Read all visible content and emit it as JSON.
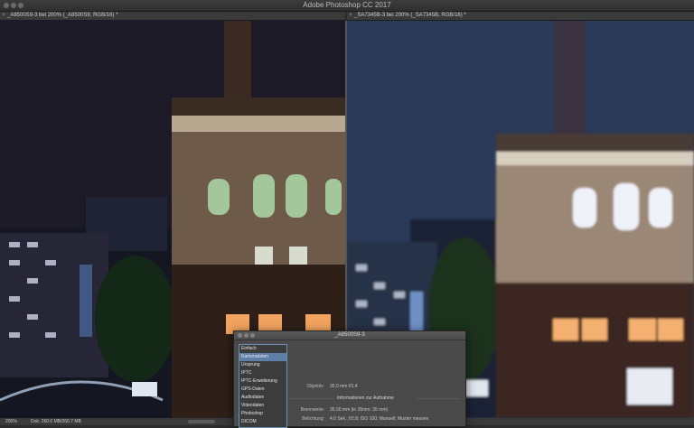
{
  "app": {
    "title": "Adobe Photoshop CC 2017"
  },
  "tabs": [
    {
      "label": "_A8500S9-3 bei 200% (_A8500S9, RGB/16) *"
    },
    {
      "label": "_SA7345B-3 bei 200% (_SA7345B, RGB/16) *"
    }
  ],
  "status": {
    "zoom": "200%",
    "doc": "Dok: 260.0 MB/260.7 MB"
  },
  "dialog": {
    "title": "_A8500S9-3",
    "categories": [
      "Einfach",
      "Kameradaten",
      "Ursprung",
      "IPTC",
      "IPTC-Erweiterung",
      "GPS-Daten",
      "Audiodaten",
      "Videodaten",
      "Photoshop",
      "DICOM"
    ],
    "selected_index": 1,
    "objektiv_label": "Objektiv:",
    "objektiv_value": "35.0 mm f/1.4",
    "section_heading": "Informationen zur Aufnahme",
    "brennweite_label": "Brennweite:",
    "brennweite_value": "35.00 mm  (in 35mm: 35 mm)",
    "belichtung_label": "Belichtung:",
    "belichtung_value": "4.0 Sek.;  f/2.8;  ISO 100;  Manuell;  Muster messen"
  },
  "colors": {
    "sky_left": "#1c1a26",
    "sky_right": "#2a3a58",
    "accent": "#5f7fa6"
  }
}
